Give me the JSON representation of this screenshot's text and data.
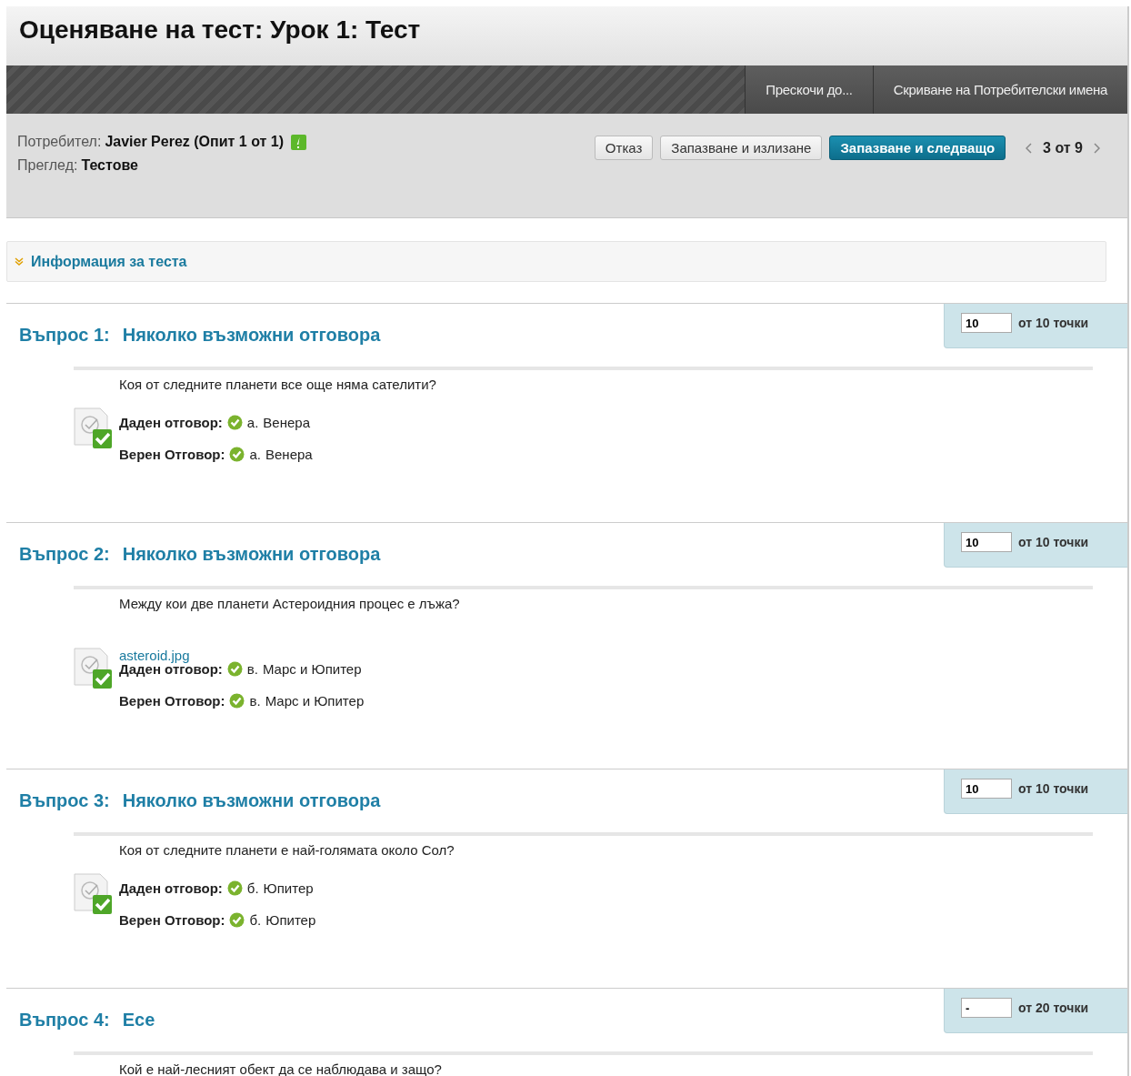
{
  "page_title": "Оценяване на тест: Урок 1: Тест",
  "action_bar": {
    "buttons": [
      "Прескочи до...",
      "Скриване на Потребителски имена"
    ]
  },
  "attempt": {
    "user_label": "Потребител:",
    "user_value": "Javier Perez (Опит 1 от 1)",
    "needs_grading": true,
    "view_label": "Преглед:",
    "view_value": "Тестове",
    "buttons": [
      {
        "label": "Отказ",
        "kind": "plain"
      },
      {
        "label": "Запазване и излизане",
        "kind": "plain"
      },
      {
        "label": "Запазване и следващо",
        "kind": "primary"
      }
    ],
    "pager": "3 от 9"
  },
  "test_info": {
    "label": "Информация за теста",
    "expanded": false
  },
  "questions": [
    {
      "number": "Въпрос 1:",
      "type": "Няколко възможни отговора",
      "score": "10",
      "score_suffix": "от 10 точки",
      "prompt": "Коя от следните планети все още няма сателити?",
      "answers": [
        {
          "label": "Даден отговор:",
          "letter": "а.",
          "text": "Венера",
          "correct": true
        },
        {
          "label": "Верен Отговор:",
          "letter": "а.",
          "text": "Венера",
          "correct": true
        }
      ]
    },
    {
      "number": "Въпрос 2:",
      "type": "Няколко възможни отговора",
      "score": "10",
      "score_suffix": "от 10 точки",
      "prompt": "Между кои две планети Астероидния процес е лъжа?",
      "attachment": "asteroid.jpg",
      "answers": [
        {
          "label": "Даден отговор:",
          "letter": "в.",
          "text": "Марс и Юпитер",
          "correct": true
        },
        {
          "label": "Верен Отговор:",
          "letter": "в.",
          "text": "Марс и Юпитер",
          "correct": true
        }
      ]
    },
    {
      "number": "Въпрос 3:",
      "type": "Няколко възможни отговора",
      "score": "10",
      "score_suffix": "от 10 точки",
      "prompt": "Коя от следните планети е най-голямата около Сол?",
      "answers": [
        {
          "label": "Даден отговор:",
          "letter": "б.",
          "text": "Юпитер",
          "correct": true
        },
        {
          "label": "Верен Отговор:",
          "letter": "б.",
          "text": "Юпитер",
          "correct": true
        }
      ]
    },
    {
      "number": "Въпрос 4:",
      "type": "Есе",
      "score": "-",
      "score_suffix": "от 20 точки",
      "prompt": "Кой е най-лесният обект да се наблюдава и защо?"
    }
  ]
}
